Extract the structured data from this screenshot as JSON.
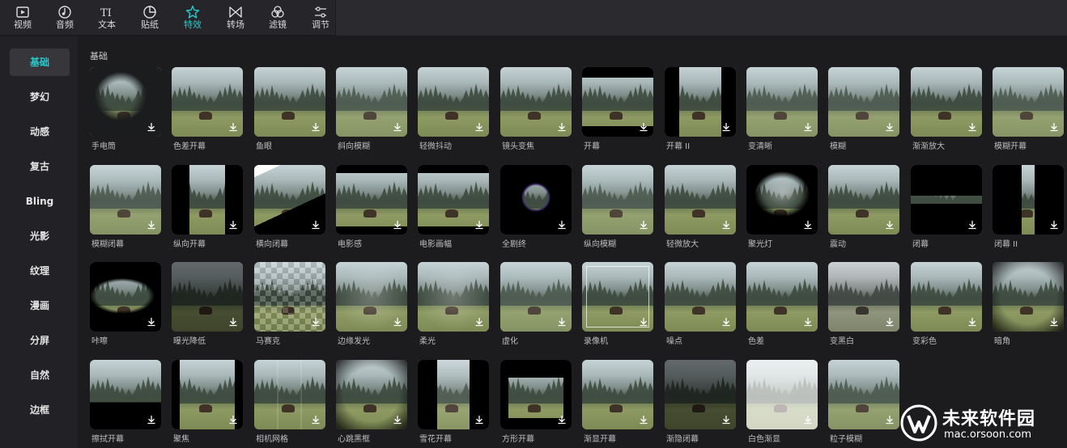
{
  "toolbar": {
    "tools": [
      {
        "label": "视频",
        "icon": "video-icon"
      },
      {
        "label": "音频",
        "icon": "audio-icon"
      },
      {
        "label": "文本",
        "icon": "text-icon"
      },
      {
        "label": "贴纸",
        "icon": "sticker-icon"
      },
      {
        "label": "特效",
        "icon": "effects-icon",
        "active": true
      },
      {
        "label": "转场",
        "icon": "transition-icon"
      },
      {
        "label": "滤镜",
        "icon": "filter-icon"
      },
      {
        "label": "调节",
        "icon": "adjust-icon"
      }
    ]
  },
  "sidebar": {
    "items": [
      "基础",
      "梦幻",
      "动感",
      "复古",
      "Bling",
      "光影",
      "纹理",
      "漫画",
      "分屏",
      "自然",
      "边框"
    ],
    "active_index": 0
  },
  "section": {
    "title": "基础"
  },
  "effects": [
    {
      "name": "手电筒",
      "fx": "flashlight"
    },
    {
      "name": "色差开幕",
      "fx": "none"
    },
    {
      "name": "鱼眼",
      "fx": "none"
    },
    {
      "name": "斜向模糊",
      "fx": "blur"
    },
    {
      "name": "轻微抖动",
      "fx": "none"
    },
    {
      "name": "镜头变焦",
      "fx": "none"
    },
    {
      "name": "开幕",
      "fx": "open"
    },
    {
      "name": "开幕 II",
      "fx": "open2"
    },
    {
      "name": "变清晰",
      "fx": "blur"
    },
    {
      "name": "模糊",
      "fx": "blur"
    },
    {
      "name": "渐渐放大",
      "fx": "none"
    },
    {
      "name": "模糊开幕",
      "fx": "blur"
    },
    {
      "name": "模糊闭幕",
      "fx": "blur"
    },
    {
      "name": "纵向开幕",
      "fx": "vopen"
    },
    {
      "name": "横向闭幕",
      "fx": "diag"
    },
    {
      "name": "电影感",
      "fx": "letterbox"
    },
    {
      "name": "电影画幅",
      "fx": "letterbox"
    },
    {
      "name": "全剧终",
      "fx": "iris"
    },
    {
      "name": "纵向模糊",
      "fx": "blur"
    },
    {
      "name": "轻微放大",
      "fx": "none"
    },
    {
      "name": "聚光灯",
      "fx": "spot"
    },
    {
      "name": "震动",
      "fx": "none"
    },
    {
      "name": "闭幕",
      "fx": "close"
    },
    {
      "name": "闭幕 II",
      "fx": "close2"
    },
    {
      "name": "咔嚓",
      "fx": "eye"
    },
    {
      "name": "曝光降低",
      "fx": "dark"
    },
    {
      "name": "马赛克",
      "fx": "mosaic"
    },
    {
      "name": "边缘发光",
      "fx": "glow"
    },
    {
      "name": "柔光",
      "fx": "glow"
    },
    {
      "name": "虚化",
      "fx": "blur"
    },
    {
      "name": "录像机",
      "fx": "rec"
    },
    {
      "name": "噪点",
      "fx": "none"
    },
    {
      "name": "色差",
      "fx": "none"
    },
    {
      "name": "变黑白",
      "fx": "gray"
    },
    {
      "name": "变彩色",
      "fx": "none"
    },
    {
      "name": "暗角",
      "fx": "vignette"
    },
    {
      "name": "擦拭开幕",
      "fx": "wipe"
    },
    {
      "name": "聚焦",
      "fx": "focus"
    },
    {
      "name": "相机网格",
      "fx": "grid"
    },
    {
      "name": "心跳黑框",
      "fx": "vignette"
    },
    {
      "name": "雪花开幕",
      "fx": "snow"
    },
    {
      "name": "方形开幕",
      "fx": "square"
    },
    {
      "name": "渐显开幕",
      "fx": "none"
    },
    {
      "name": "渐隐闭幕",
      "fx": "dark"
    },
    {
      "name": "白色渐显",
      "fx": "white"
    },
    {
      "name": "粒子模糊",
      "fx": "blur"
    }
  ],
  "watermark": {
    "title": "未来软件园",
    "url": "mac.orsoon.com"
  }
}
